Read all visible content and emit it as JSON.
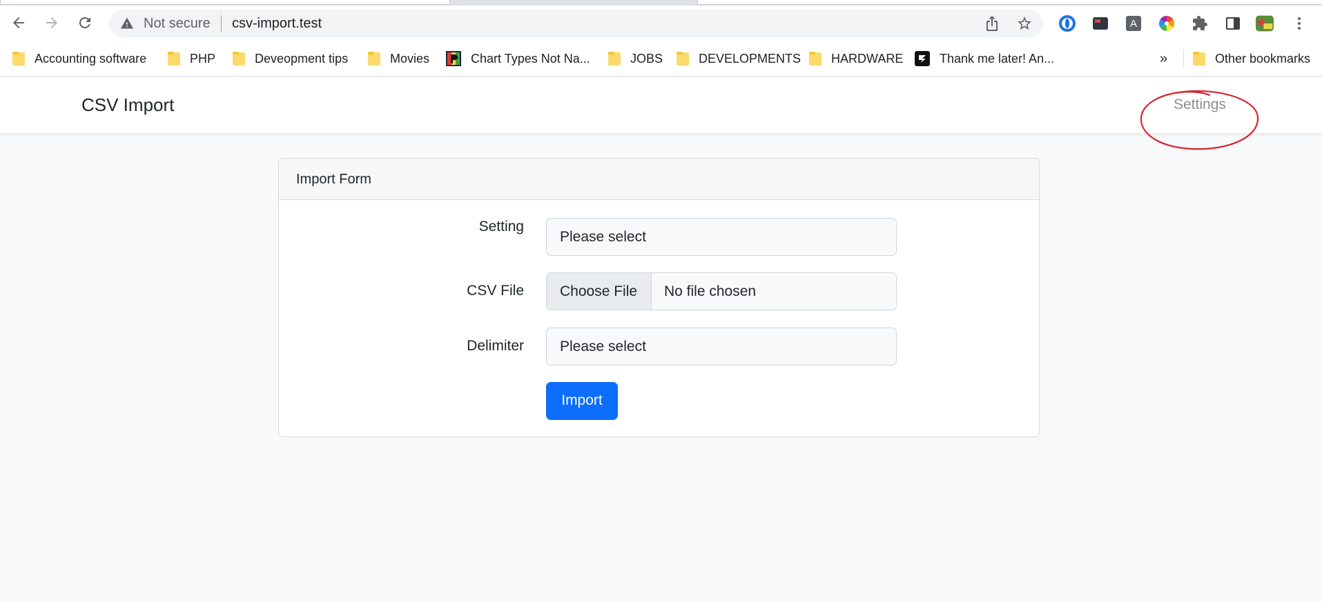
{
  "browser": {
    "security_label": "Not secure",
    "url": "csv-import.test",
    "bookmarks": [
      {
        "label": "Accounting software",
        "icon": "folder-icon"
      },
      {
        "label": "PHP",
        "icon": "folder-icon"
      },
      {
        "label": "Deveopment tips",
        "icon": "folder-icon"
      },
      {
        "label": "Movies",
        "icon": "folder-icon"
      },
      {
        "label": "Chart Types Not Na...",
        "icon": "site-favicon"
      },
      {
        "label": "JOBS",
        "icon": "folder-icon"
      },
      {
        "label": "DEVELOPMENTS",
        "icon": "folder-icon"
      },
      {
        "label": "HARDWARE",
        "icon": "folder-icon"
      },
      {
        "label": "Thank me later! An...",
        "icon": "site-favicon"
      }
    ],
    "overflow_label": "»",
    "other_bookmarks": "Other bookmarks",
    "ext_font_letter": "A",
    "colors": {
      "folder": "#fbd96b",
      "accent": "#0d6efd",
      "annotation": "#d9232d"
    }
  },
  "navbar": {
    "brand": "CSV Import",
    "settings_link": "Settings"
  },
  "form": {
    "title": "Import Form",
    "setting_label": "Setting",
    "setting_value": "Please select",
    "csv_label": "CSV File",
    "choose_file": "Choose File",
    "file_status": "No file chosen",
    "delimiter_label": "Delimiter",
    "delimiter_value": "Please select",
    "import_button": "Import"
  }
}
